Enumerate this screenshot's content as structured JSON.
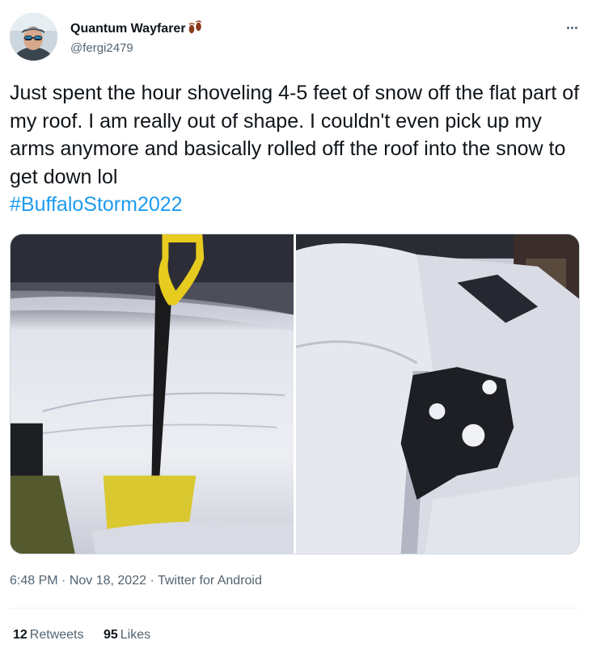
{
  "tweet": {
    "author": {
      "display_name": "Quantum Wayfarer",
      "handle": "@fergi2479",
      "name_emoji_icon": "footprints-icon"
    },
    "text": "Just spent the hour shoveling 4-5 feet of snow off the flat part of my roof. I am really out of shape. I couldn't even pick up my arms anymore and basically rolled off the roof into the snow to get down lol\n",
    "hashtag": "#BuffaloStorm2022",
    "time": "6:48 PM",
    "date": "Nov 18, 2022",
    "source": "Twitter for Android",
    "separator": " · ",
    "stats": {
      "retweets_count": "12",
      "retweets_label": "Retweets",
      "likes_count": "95",
      "likes_label": "Likes"
    },
    "media": [
      {
        "icon": "snow-shovel-photo"
      },
      {
        "icon": "snow-roof-photo"
      }
    ]
  },
  "colors": {
    "text": "#0f1419",
    "secondary": "#536471",
    "link": "#1d9bf0",
    "divider": "#eff3f4"
  }
}
